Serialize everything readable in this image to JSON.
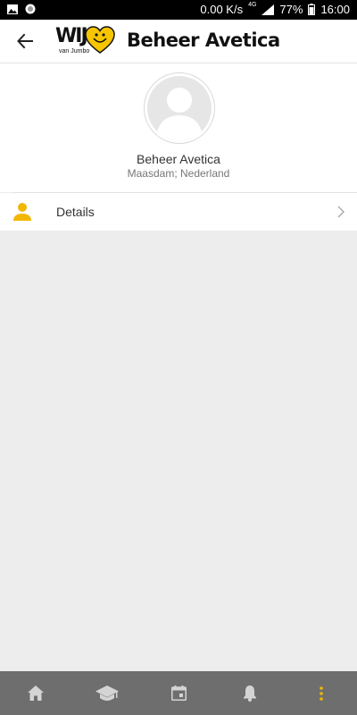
{
  "status_bar": {
    "speed": "0.00 K/s",
    "network": "4G",
    "battery": "77%",
    "time": "16:00"
  },
  "app_bar": {
    "logo_text": "WIJ",
    "logo_subtext": "van Jumbo",
    "title": "Beheer Avetica"
  },
  "profile": {
    "name": "Beheer Avetica",
    "location": "Maasdam; Nederland"
  },
  "menu": {
    "details_label": "Details"
  },
  "bottom_nav": {
    "items": [
      {
        "icon": "home-icon"
      },
      {
        "icon": "graduation-cap-icon"
      },
      {
        "icon": "calendar-icon"
      },
      {
        "icon": "bell-icon"
      },
      {
        "icon": "more-vertical-icon",
        "active": true
      }
    ]
  },
  "colors": {
    "accent": "#f2b705",
    "nav_background": "#6e6e6e",
    "content_background": "#ededed"
  }
}
